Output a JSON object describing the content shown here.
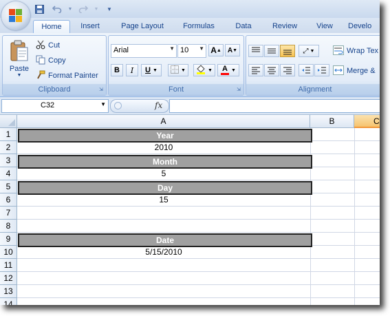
{
  "colors": {
    "accent": "#f6c46e",
    "ribbon": "#dbe6f4",
    "header_cell_fill": "#a0a0a0"
  },
  "quick_access": {
    "icons": [
      "save-icon",
      "undo-icon",
      "redo-icon",
      "customize-icon"
    ]
  },
  "ribbon_tabs": [
    {
      "label": "Home",
      "active": true
    },
    {
      "label": "Insert"
    },
    {
      "label": "Page Layout"
    },
    {
      "label": "Formulas"
    },
    {
      "label": "Data"
    },
    {
      "label": "Review"
    },
    {
      "label": "View"
    },
    {
      "label": "Develo"
    }
  ],
  "clipboard": {
    "paste": "Paste",
    "cut": "Cut",
    "copy": "Copy",
    "format_painter": "Format Painter",
    "label": "Clipboard"
  },
  "font": {
    "name": "Arial",
    "size": "10",
    "bold": "B",
    "italic": "I",
    "underline": "U",
    "grow": "A",
    "shrink": "A",
    "label": "Font",
    "color_letter": "A"
  },
  "alignment": {
    "wrap_text": "Wrap Tex",
    "merge": "Merge &",
    "label": "Alignment"
  },
  "formula_bar": {
    "name_box": "C32",
    "fx": "fx",
    "formula": ""
  },
  "columns": [
    "A",
    "B",
    "C"
  ],
  "rows": [
    {
      "n": "1",
      "a": "Year",
      "header": true
    },
    {
      "n": "2",
      "a": "2010"
    },
    {
      "n": "3",
      "a": "Month",
      "header": true
    },
    {
      "n": "4",
      "a": "5"
    },
    {
      "n": "5",
      "a": "Day",
      "header": true
    },
    {
      "n": "6",
      "a": "15"
    },
    {
      "n": "7",
      "a": ""
    },
    {
      "n": "8",
      "a": ""
    },
    {
      "n": "9",
      "a": "Date",
      "header": true
    },
    {
      "n": "10",
      "a": "5/15/2010"
    },
    {
      "n": "11",
      "a": ""
    },
    {
      "n": "12",
      "a": ""
    },
    {
      "n": "13",
      "a": ""
    },
    {
      "n": "14",
      "a": ""
    }
  ]
}
